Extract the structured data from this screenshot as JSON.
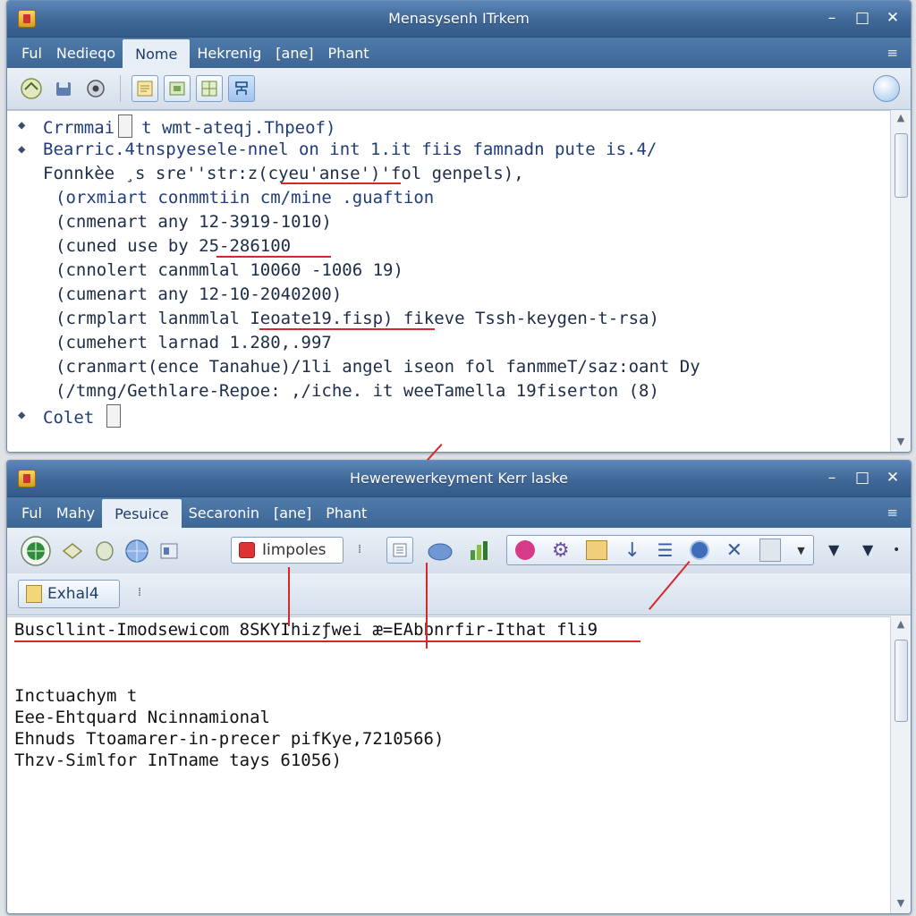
{
  "window1": {
    "title": "Menasysenh ITrkem",
    "menu": [
      "Ful",
      "Nedieqo",
      "Nome",
      "Hekrenig",
      "[ane]",
      "Phant"
    ],
    "active_menu_index": 2,
    "lines": [
      "Crrmmai",
      "t wmt-ateqj.Thpeof)",
      "Bearric.4tnspyesele-nnel on int 1.it fiis famnadn pute is.4/",
      "Fonnkèe ¸s sre''str:z(cyeu'anse')'fol genpels),",
      "(orxmiart conmmtiin cm/mine .guaftion",
      "(cnmenart any 12-3919-1010)",
      "(cuned use by 25-286100",
      "(cnnolert canmmlal 10060 -1006 19)",
      "(cumenart any 12-10-2040200)",
      "(crmplart lanmmlal Ieoate19.fisp) fikeve Tssh-keygen-t-rsa)",
      "(cumehert larnad 1.280,.997",
      "(cranmart(ence Tanahue)/1li angel iseon fol fanmmeT/saz:oant Dy",
      "(/tmng/Gethlare-Repoe: ,/iche. it weeTamella 19fiserton (8)",
      "Colet"
    ]
  },
  "window2": {
    "title": "Hewerewerkeyment Kerr laske",
    "menu": [
      "Ful",
      "Mahy",
      "Pesuice",
      "Secaronin",
      "[ane]",
      "Phant"
    ],
    "active_menu_index": 2,
    "search_text": "Iimpoles",
    "tag_label": "Exhal4",
    "lines": [
      "Buscllint-Imodsewicom 8SKYIhizƒwei æ=EAbbnrfir-Ithat fli9",
      "Inctuachym t",
      "Eee-Ehtquard Ncinnamional",
      "Ehnuds Ttoamarer-in-precer pifKye,7210566)",
      "Thzv-Simlfor InTname tays 61056)"
    ]
  },
  "colors": {
    "titlebar": "#3f6797",
    "annotation": "#d8262b",
    "text": "#1c2d47"
  }
}
